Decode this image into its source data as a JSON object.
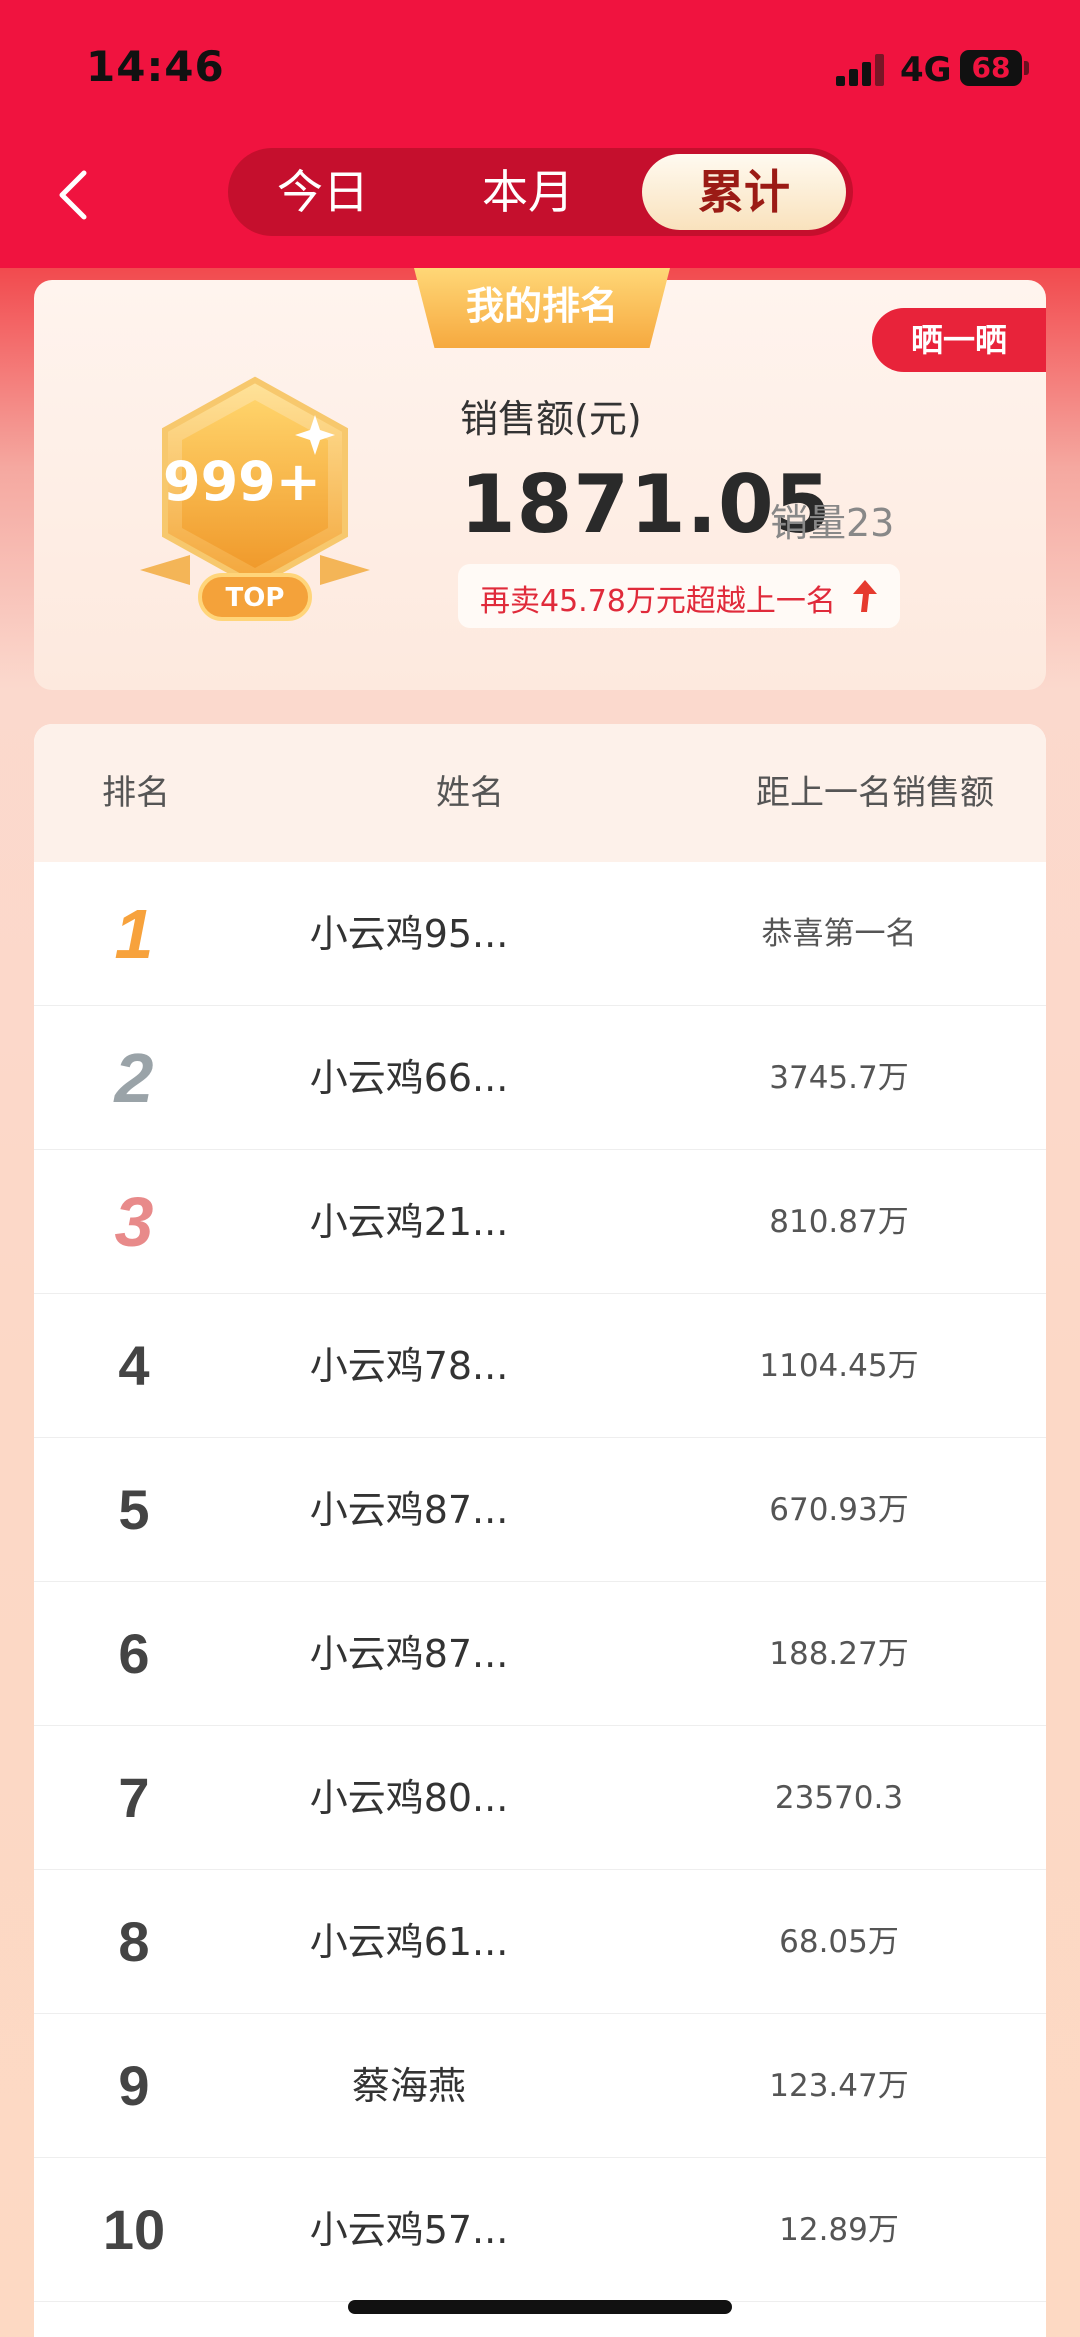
{
  "status": {
    "time": "14:46",
    "network": "4G",
    "battery": "68"
  },
  "tabs": [
    {
      "label": "今日",
      "active": false
    },
    {
      "label": "本月",
      "active": false
    },
    {
      "label": "累计",
      "active": true
    }
  ],
  "my_card": {
    "tag": "我的排名",
    "share_label": "晒一晒",
    "badge_rank": "999+",
    "badge_sub": "TOP",
    "sales_label": "销售额(元)",
    "sales_amount": "1871.05",
    "sales_count": "销量23",
    "hint": "再卖45.78万元超越上一名"
  },
  "table": {
    "headers": [
      "排名",
      "姓名",
      "距上一名销售额"
    ],
    "rows": [
      {
        "rank": "1",
        "name": "小云鸡95...",
        "gap": "恭喜第一名"
      },
      {
        "rank": "2",
        "name": "小云鸡66...",
        "gap": "3745.7万"
      },
      {
        "rank": "3",
        "name": "小云鸡21...",
        "gap": "810.87万"
      },
      {
        "rank": "4",
        "name": "小云鸡78...",
        "gap": "1104.45万"
      },
      {
        "rank": "5",
        "name": "小云鸡87...",
        "gap": "670.93万"
      },
      {
        "rank": "6",
        "name": "小云鸡87...",
        "gap": "188.27万"
      },
      {
        "rank": "7",
        "name": "小云鸡80...",
        "gap": "23570.3"
      },
      {
        "rank": "8",
        "name": "小云鸡61...",
        "gap": "68.05万"
      },
      {
        "rank": "9",
        "name": "蔡海燕",
        "gap": "123.47万"
      },
      {
        "rank": "10",
        "name": "小云鸡57...",
        "gap": "12.89万"
      }
    ]
  },
  "colors": {
    "header_red": "#f0133f",
    "accent_gold": "#f6a93f",
    "hint_red": "#e02a3a"
  }
}
